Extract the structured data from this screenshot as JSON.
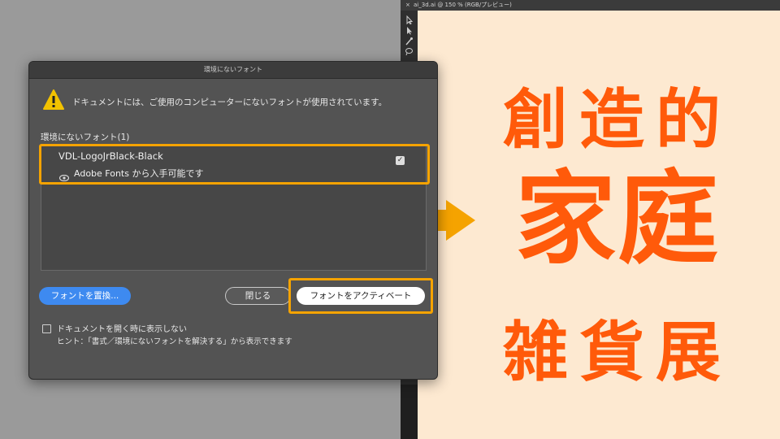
{
  "document_tab": {
    "close_glyph": "×",
    "title": "ai_3d.ai @ 150 % (RGB/プレビュー)"
  },
  "dialog": {
    "title": "環境にないフォント",
    "warning_icon": "warning-triangle-icon",
    "message": "ドキュメントには、ご使用のコンピューターにないフォントが使用されています。",
    "list_label": "環境にないフォント(1)",
    "fonts": [
      {
        "name": "VDL-LogoJrBlack-Black",
        "status": "Adobe Fonts から入手可能です",
        "checked": true,
        "check_glyph": "✓"
      }
    ],
    "replace_button": "フォントを置換...",
    "close_button": "閉じる",
    "activate_button": "フォントをアクティベート",
    "dont_show_label": "ドキュメントを開く時に表示しない",
    "hint": "ヒント：「書式／環境にないフォントを解決する」から表示できます"
  },
  "artwork": {
    "line1": "創造的",
    "line2": "家庭",
    "line3": "雑貨展",
    "color": "#ff5a0a",
    "background": "#fde9d1"
  },
  "colors": {
    "highlight": "#f5a300",
    "arrow": "#f5a300",
    "primary_button": "#3e8af0"
  }
}
